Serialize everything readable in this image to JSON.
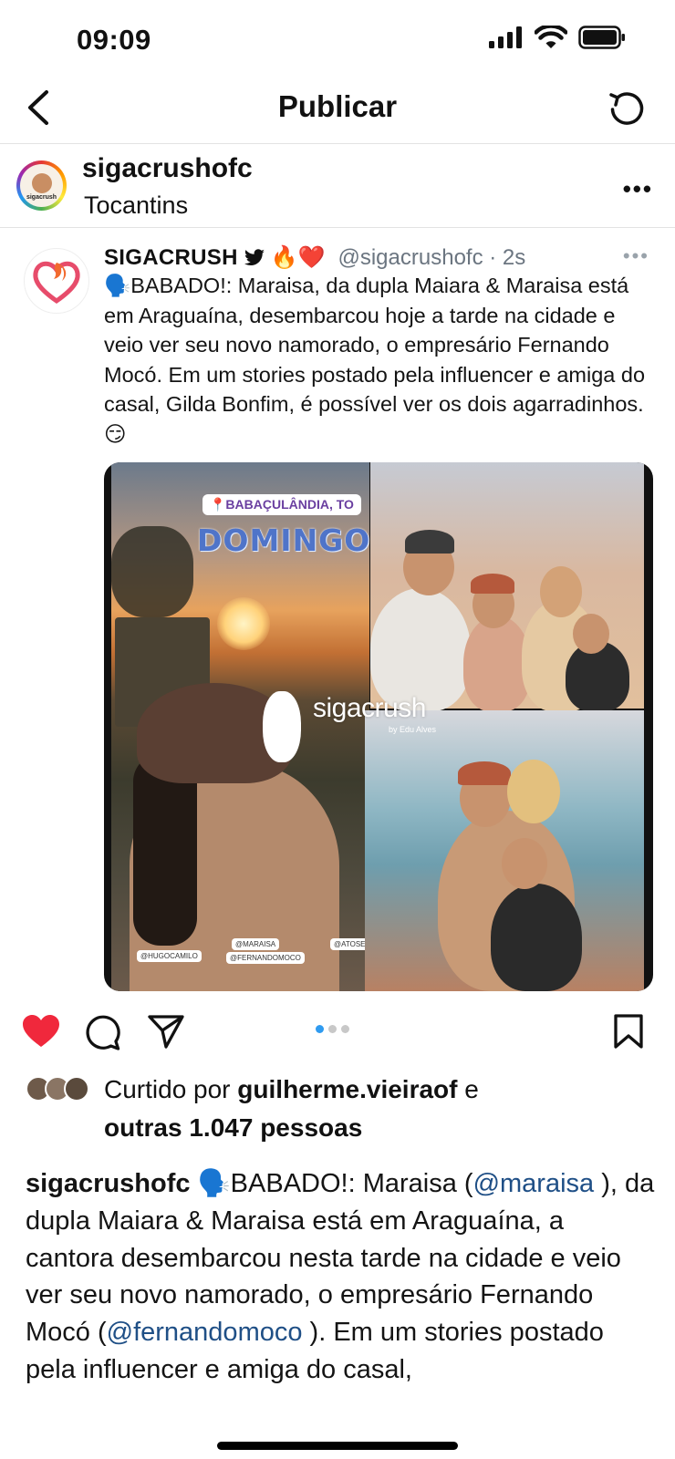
{
  "status_bar": {
    "time": "09:09"
  },
  "header": {
    "title": "Publicar"
  },
  "author": {
    "username": "sigacrushofc",
    "location": "Tocantins",
    "avatar_label": "sigacrush"
  },
  "tweet": {
    "display_name": "SIGACRUSH",
    "name_emojis": "🔥❤️",
    "handle": "@sigacrushofc · 2s",
    "more": "•••",
    "text": "🗣️BABADO!: Maraisa, da dupla Maiara & Maraisa está em Araguaína, desembarcou hoje a tarde na cidade e veio ver seu novo namorado, o empresário Fernando Mocó. Em um stories postado pela influencer e amiga do casal, Gilda Bonfim, é possível ver os dois agarradinhos. 😏"
  },
  "photo": {
    "location_sticker": "📍BABAÇULÂNDIA, TO",
    "day_sticker": "DOMINGO",
    "watermark": "sigacrush",
    "watermark_sub": "by Edu Alves",
    "tags": [
      "@HUGOCAMILO",
      "@MARAISA",
      "@FERNANDOMOCO",
      "@ATOSEH"
    ]
  },
  "carousel": {
    "count": 3,
    "active": 0
  },
  "likes": {
    "prefix": "Curtido por ",
    "user": "guilherme.vieiraof",
    "middle": " e ",
    "others": "outras 1.047 pessoas"
  },
  "caption": {
    "username": "sigacrushofc",
    "part1": " 🗣️BABADO!: Maraisa (",
    "mention1": "@maraisa",
    "part2": " ), da dupla Maiara & Maraisa está em Araguaína, a cantora desembarcou nesta tarde na cidade e veio ver seu novo namorado, o empresário Fernando Mocó (",
    "mention2": "@fernandomoco",
    "part3": " ). Em um stories postado pela influencer e amiga do casal,"
  },
  "colors": {
    "like_red": "#f0283c",
    "mention_blue": "#1f4f86",
    "dot_active": "#2f9bf0",
    "twitter_black": "#111111"
  },
  "icons": [
    "signal-icon",
    "wifi-icon",
    "battery-icon",
    "back-icon",
    "refresh-icon",
    "more-icon",
    "heart-icon",
    "comment-icon",
    "share-icon",
    "bookmark-icon"
  ]
}
